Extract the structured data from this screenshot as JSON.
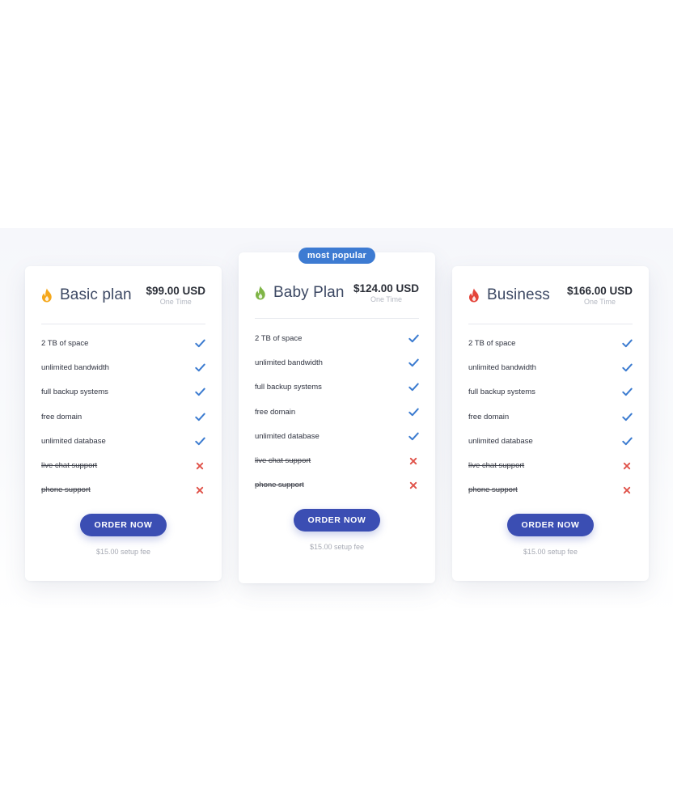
{
  "colors": {
    "accent_button": "#3b4eb3",
    "ribbon": "#3d7bd2",
    "check": "#3b7bd0",
    "cross": "#e0534a"
  },
  "plans": [
    {
      "id": "basic",
      "name": "Basic plan",
      "flame_color": "#f5a81c",
      "flame_icon": "flame-icon",
      "price": "$99.00 USD",
      "price_note": "One Time",
      "features": [
        {
          "label": "2 TB of space",
          "included": true
        },
        {
          "label": "unlimited bandwidth",
          "included": true
        },
        {
          "label": "full backup systems",
          "included": true
        },
        {
          "label": "free domain",
          "included": true
        },
        {
          "label": "unlimited database",
          "included": true
        },
        {
          "label": "live chat support",
          "included": false
        },
        {
          "label": "phone support",
          "included": false
        }
      ],
      "button_label": "ORDER NOW",
      "setup_fee": "$15.00 setup fee"
    },
    {
      "id": "baby",
      "name": "Baby Plan",
      "flame_color": "#7fb546",
      "flame_icon": "flame-icon",
      "badge": "most popular",
      "price": "$124.00 USD",
      "price_note": "One Time",
      "features": [
        {
          "label": "2 TB of space",
          "included": true
        },
        {
          "label": "unlimited bandwidth",
          "included": true
        },
        {
          "label": "full backup systems",
          "included": true
        },
        {
          "label": "free domain",
          "included": true
        },
        {
          "label": "unlimited database",
          "included": true
        },
        {
          "label": "live chat support",
          "included": false
        },
        {
          "label": "phone support",
          "included": false
        }
      ],
      "button_label": "ORDER NOW",
      "setup_fee": "$15.00 setup fee"
    },
    {
      "id": "business",
      "name": "Business",
      "flame_color": "#e4443a",
      "flame_icon": "flame-icon",
      "price": "$166.00 USD",
      "price_note": "One Time",
      "features": [
        {
          "label": "2 TB of space",
          "included": true
        },
        {
          "label": "unlimited bandwidth",
          "included": true
        },
        {
          "label": "full backup systems",
          "included": true
        },
        {
          "label": "free domain",
          "included": true
        },
        {
          "label": "unlimited database",
          "included": true
        },
        {
          "label": "live chat support",
          "included": false
        },
        {
          "label": "phone support",
          "included": false
        }
      ],
      "button_label": "ORDER NOW",
      "setup_fee": "$15.00 setup fee"
    }
  ]
}
